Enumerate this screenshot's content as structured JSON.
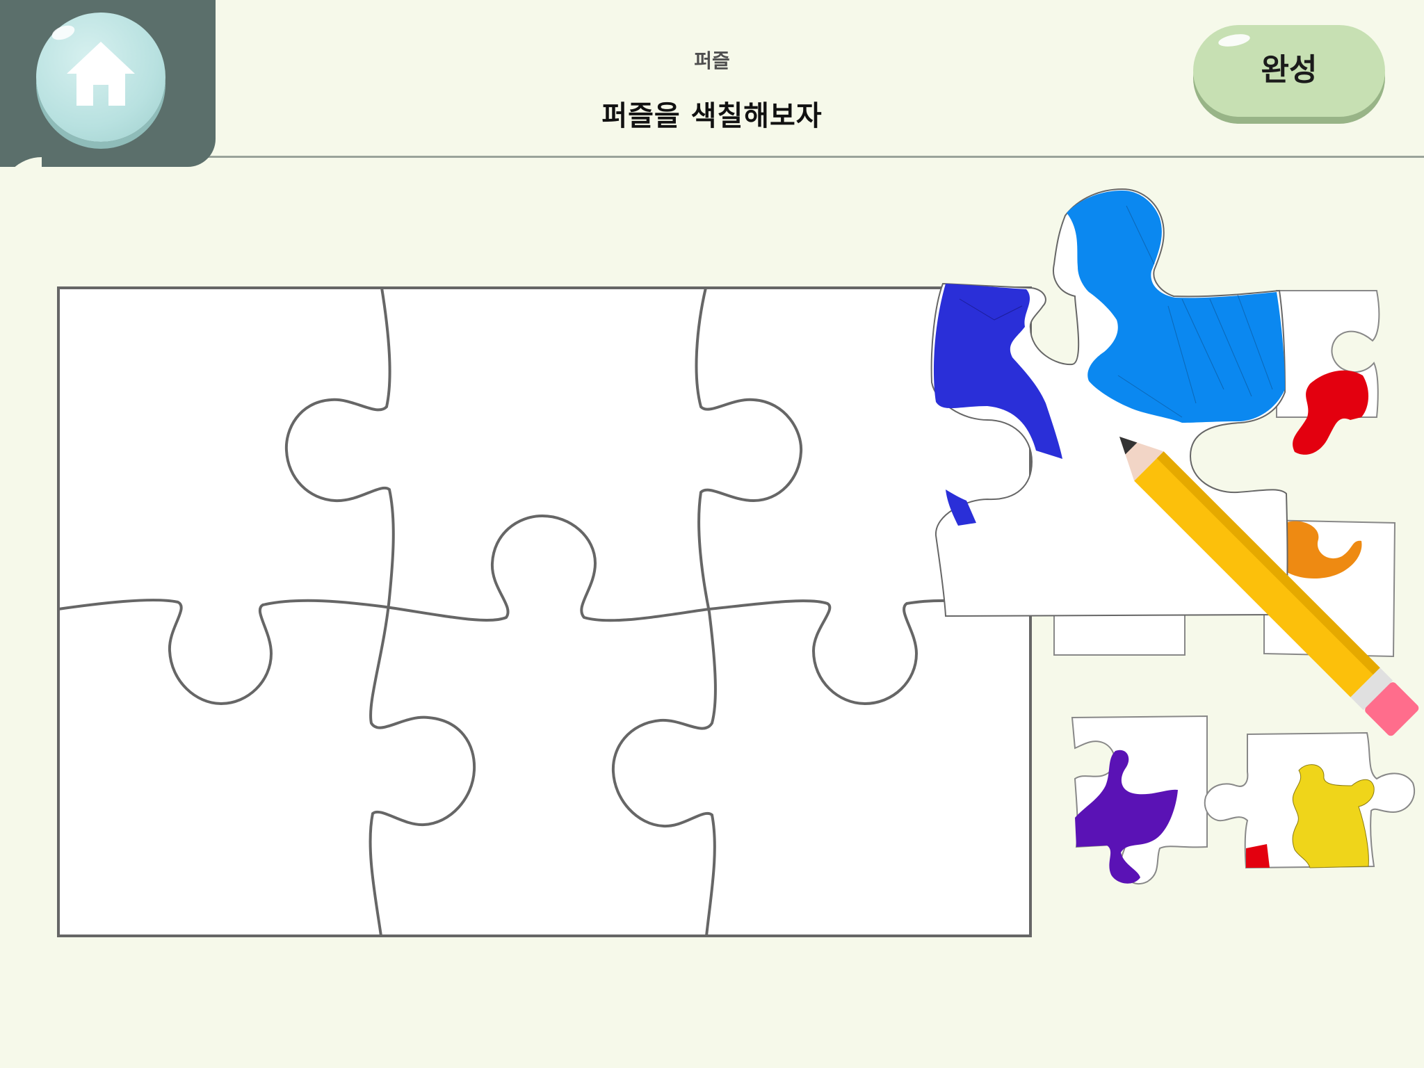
{
  "header": {
    "category": "퍼즐",
    "instruction": "퍼즐을 색칠해보자",
    "done_label": "완성"
  },
  "icons": {
    "home": "home-icon",
    "pencil": "pencil-icon"
  },
  "colors": {
    "background": "#f6f9ea",
    "home_panel": "#5b6f6b",
    "home_button": "#b8e1e0",
    "done_button": "#c7e0b3",
    "board_outline": "#666666",
    "pencil_body": "#fcc00b",
    "pencil_eraser": "#ff6d8c"
  },
  "puzzle": {
    "rows": 2,
    "columns": 3,
    "pieces": [
      {
        "name": "piece-blue",
        "colors": [
          "#0b88f0",
          "#2a2fd8"
        ]
      },
      {
        "name": "piece-red",
        "colors": [
          "#e3000f"
        ]
      },
      {
        "name": "piece-orange",
        "colors": [
          "#ee8a12"
        ]
      },
      {
        "name": "piece-white",
        "colors": []
      },
      {
        "name": "piece-purple",
        "colors": [
          "#5a12b5"
        ]
      },
      {
        "name": "piece-yellow",
        "colors": [
          "#efd51a",
          "#e3000f"
        ]
      }
    ]
  }
}
